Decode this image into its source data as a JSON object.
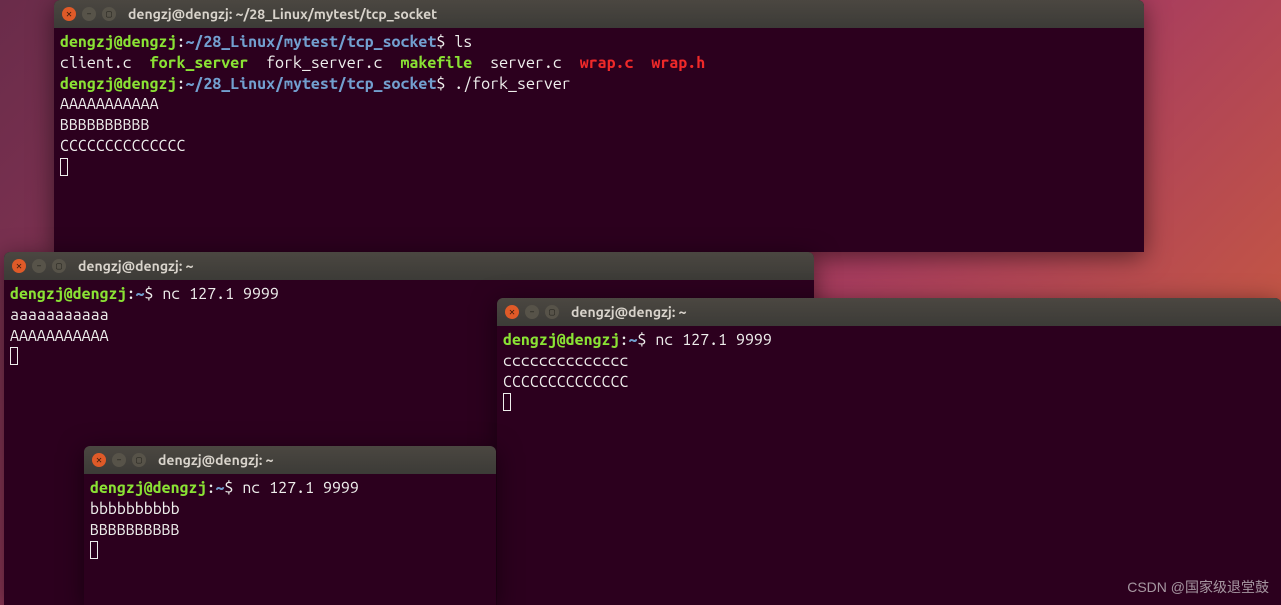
{
  "watermark": "CSDN @国家级退堂鼓",
  "term1": {
    "title": "dengzj@dengzj: ~/28_Linux/mytest/tcp_socket",
    "user": "dengzj@dengzj",
    "colon": ":",
    "path": "~/28_Linux/mytest/tcp_socket",
    "prompt": "$ ",
    "cmd1": "ls",
    "ls": {
      "f1": "client.c",
      "f2": "fork_server",
      "f3": "fork_server.c",
      "f4": "makefile",
      "f5": "server.c",
      "f6": "wrap.c",
      "f7": "wrap.h"
    },
    "cmd2": "./fork_server",
    "out1": "AAAAAAAAAAA",
    "out2": "BBBBBBBBBB",
    "out3": "CCCCCCCCCCCCCC"
  },
  "term2": {
    "title": "dengzj@dengzj: ~",
    "user": "dengzj@dengzj",
    "colon": ":",
    "path": "~",
    "prompt": "$ ",
    "cmd": "nc 127.1 9999",
    "in": "aaaaaaaaaaa",
    "out": "AAAAAAAAAAA"
  },
  "term3": {
    "title": "dengzj@dengzj: ~",
    "user": "dengzj@dengzj",
    "colon": ":",
    "path": "~",
    "prompt": "$ ",
    "cmd": "nc 127.1 9999",
    "in": "bbbbbbbbbb",
    "out": "BBBBBBBBBB"
  },
  "term4": {
    "title": "dengzj@dengzj: ~",
    "user": "dengzj@dengzj",
    "colon": ":",
    "path": "~",
    "prompt": "$ ",
    "cmd": "nc 127.1 9999",
    "in": "cccccccccccccc",
    "out": "CCCCCCCCCCCCCC"
  }
}
